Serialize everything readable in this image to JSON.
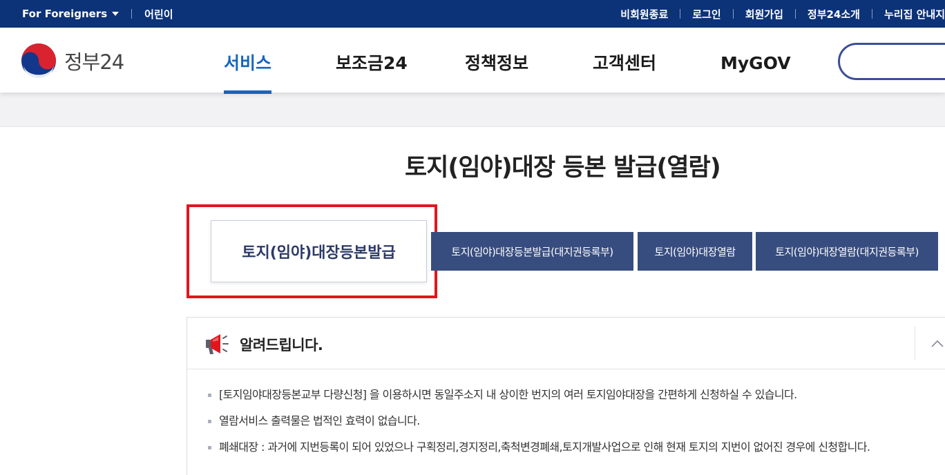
{
  "topbar": {
    "foreigners": "For Foreigners",
    "kids": "어린이",
    "links": [
      "비회원종료",
      "로그인",
      "회원가입",
      "정부24소개",
      "누리집 안내지"
    ]
  },
  "header": {
    "logo_text": "정부24",
    "nav": [
      "서비스",
      "보조금24",
      "정책정보",
      "고객센터",
      "MyGOV"
    ],
    "active_nav": "서비스"
  },
  "page": {
    "title": "토지(임야)대장 등본 발급(열람)"
  },
  "tabs": [
    "토지(임야)대장등본발급",
    "토지(임야)대장등본발급(대지권등록부)",
    "토지(임야)대장열람",
    "토지(임야)대장열람(대지권등록부)"
  ],
  "notice": {
    "title": "알려드립니다.",
    "items": [
      "[토지임야대장등본교부 다량신청] 을 이용하시면 동일주소지 내 상이한 번지의 여러 토지임야대장을 간편하게 신청하실 수 있습니다.",
      "열람서비스 출력물은 법적인 효력이 없습니다.",
      "폐쇄대장 : 과거에 지번등록이 되어 있었으나 구획정리,경지정리,축척변경폐쇄,토지개발사업으로 인해 현재 토지의 지번이 없어진 경우에 신청합니다."
    ]
  },
  "colors": {
    "topbar_bg": "#0c3278",
    "nav_active": "#1565c0",
    "tab_bg": "#384d7f",
    "highlight": "#e0161e"
  }
}
